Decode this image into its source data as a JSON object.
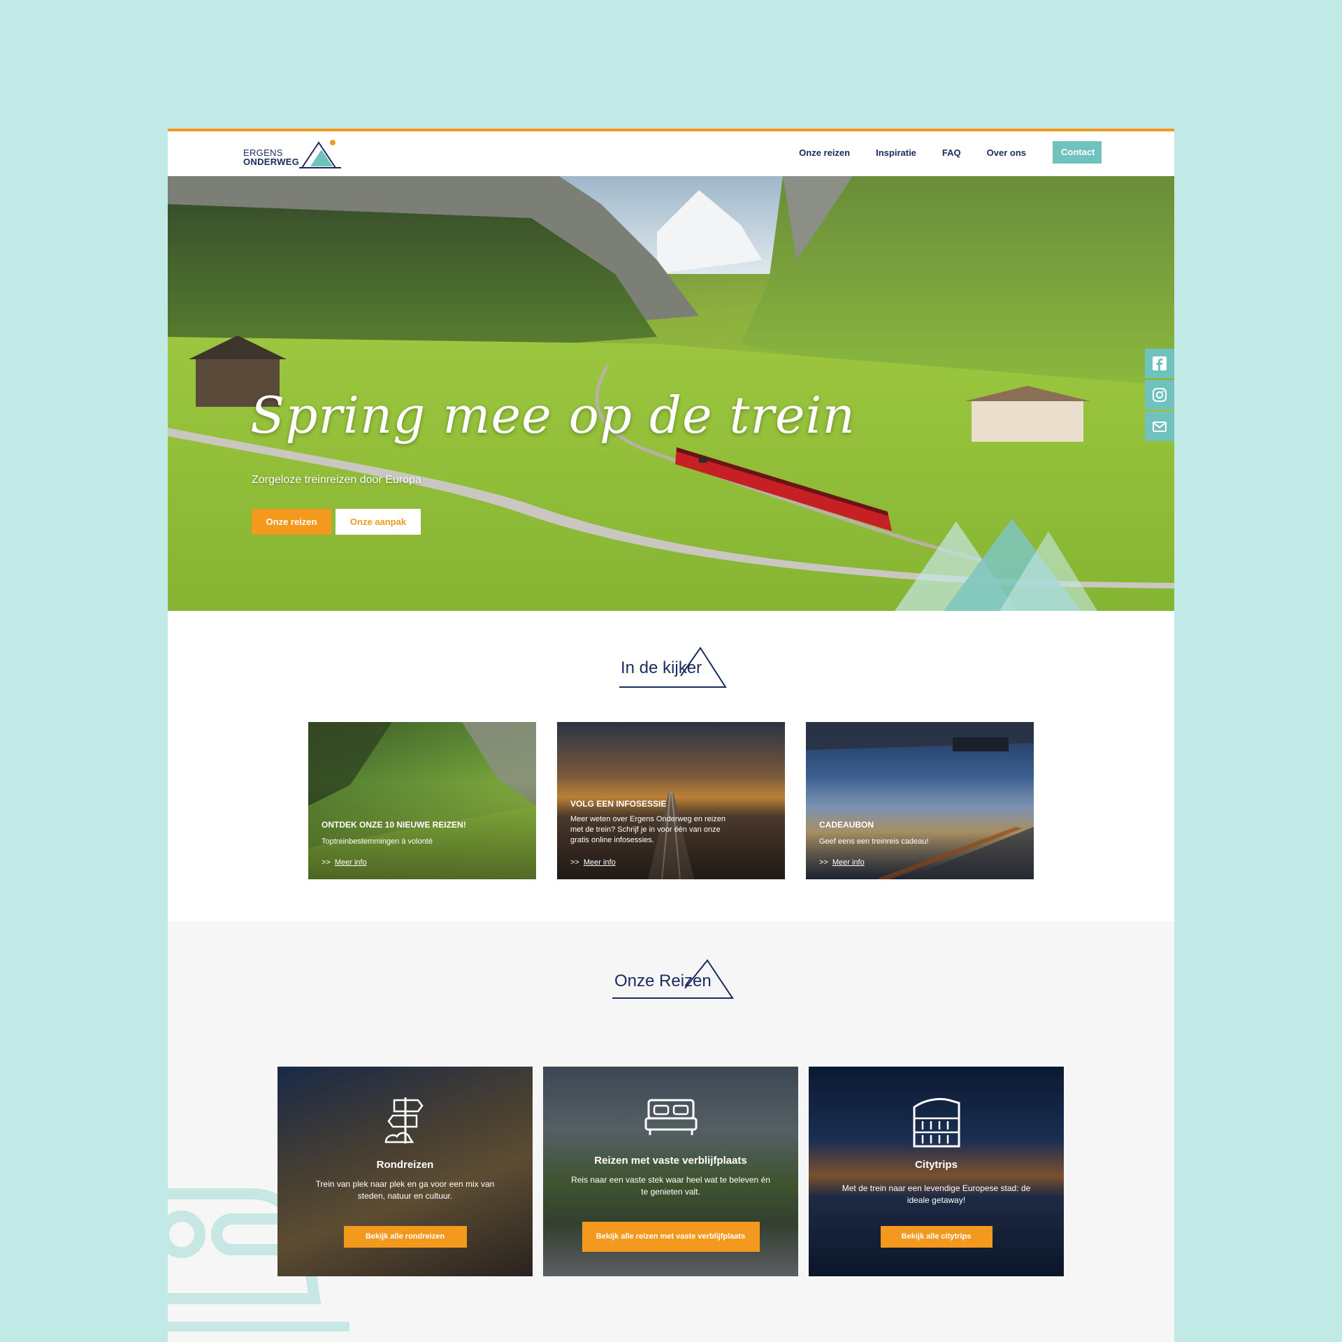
{
  "logo": {
    "line1": "ERGENS",
    "line2": "ONDERWEG"
  },
  "nav": {
    "items": [
      "Onze reizen",
      "Inspiratie",
      "FAQ",
      "Over ons"
    ],
    "contact": "Contact"
  },
  "hero": {
    "title": "Spring mee op de trein",
    "subtitle": "Zorgeloze treinreizen door Europa",
    "btn_primary": "Onze reizen",
    "btn_secondary": "Onze aanpak"
  },
  "social": [
    "facebook-icon",
    "instagram-icon",
    "mail-icon"
  ],
  "kijker": {
    "title": "In de kijker",
    "cards": [
      {
        "title": "ONTDEK ONZE 10 NIEUWE REIZEN!",
        "desc": "Toptreinbestemmingen à volonté",
        "more_prefix": ">>",
        "more": "Meer info"
      },
      {
        "title": "VOLG EEN INFOSESSIE",
        "desc": "Meer weten over Ergens Onderweg en reizen met de trein? Schrijf je in voor één van onze gratis online infosessies.",
        "more_prefix": ">>",
        "more": "Meer info"
      },
      {
        "title": "CADEAUBON",
        "desc": "Geef eens een treinreis cadeau!",
        "more_prefix": ">>",
        "more": "Meer info"
      }
    ]
  },
  "reizen": {
    "title": "Onze Reizen",
    "cards": [
      {
        "title": "Rondreizen",
        "desc": "Trein van plek naar plek en ga voor een mix van steden, natuur en cultuur.",
        "button": "Bekijk alle rondreizen"
      },
      {
        "title": "Reizen met vaste verblijfplaats",
        "desc": "Reis naar een vaste stek waar heel wat te beleven én te genieten valt.",
        "button": "Bekijk alle reizen met vaste verblijfplaats"
      },
      {
        "title": "Citytrips",
        "desc": "Met de trein naar een levendige Europese stad: de ideale getaway!",
        "button": "Bekijk alle citytrips"
      }
    ]
  },
  "colors": {
    "accent": "#f39a1e",
    "teal": "#6fc2bd",
    "navy": "#1c2b5f",
    "background": "#c1eae6"
  }
}
